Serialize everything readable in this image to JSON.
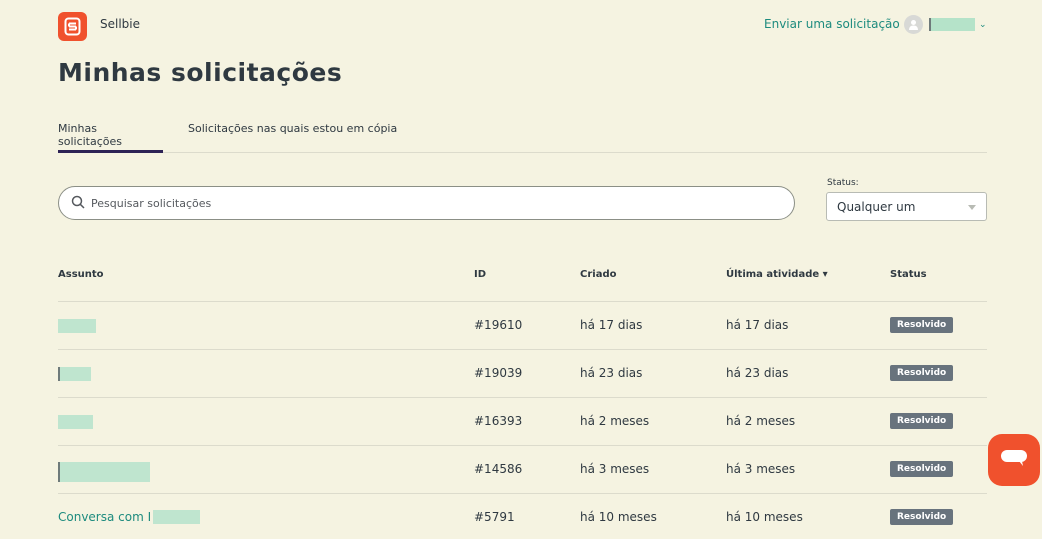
{
  "header": {
    "brand": "Sellbie",
    "submit_request": "Enviar uma solicitação"
  },
  "page_title": "Minhas solicitações",
  "tabs": [
    {
      "label": "Minhas solicitações",
      "active": true
    },
    {
      "label": "Solicitações nas quais estou em cópia",
      "active": false
    }
  ],
  "search": {
    "placeholder": "Pesquisar solicitações"
  },
  "status_filter": {
    "label": "Status:",
    "value": "Qualquer um"
  },
  "table": {
    "headers": {
      "subject": "Assunto",
      "id": "ID",
      "created": "Criado",
      "last_activity": "Última atividade ▾",
      "status": "Status"
    },
    "rows": [
      {
        "subject": "",
        "id": "#19610",
        "created": "há 17 dias",
        "last_activity": "há 17 dias",
        "status": "Resolvido"
      },
      {
        "subject": "",
        "id": "#19039",
        "created": "há 23 dias",
        "last_activity": "há 23 dias",
        "status": "Resolvido"
      },
      {
        "subject": "",
        "id": "#16393",
        "created": "há 2 meses",
        "last_activity": "há 2 meses",
        "status": "Resolvido"
      },
      {
        "subject": "",
        "id": "#14586",
        "created": "há 3 meses",
        "last_activity": "há 3 meses",
        "status": "Resolvido"
      },
      {
        "subject": "Conversa com I",
        "id": "#5791",
        "created": "há 10 meses",
        "last_activity": "há 10 meses",
        "status": "Resolvido"
      }
    ]
  },
  "colors": {
    "brand": "#f0512d",
    "link": "#1d8b7e",
    "badge": "#68737d",
    "background": "#f5f3e1"
  },
  "icons": {
    "logo": "sellbie-logo-icon",
    "search": "search-icon",
    "chat": "chat-icon",
    "avatar": "user-avatar-icon"
  }
}
